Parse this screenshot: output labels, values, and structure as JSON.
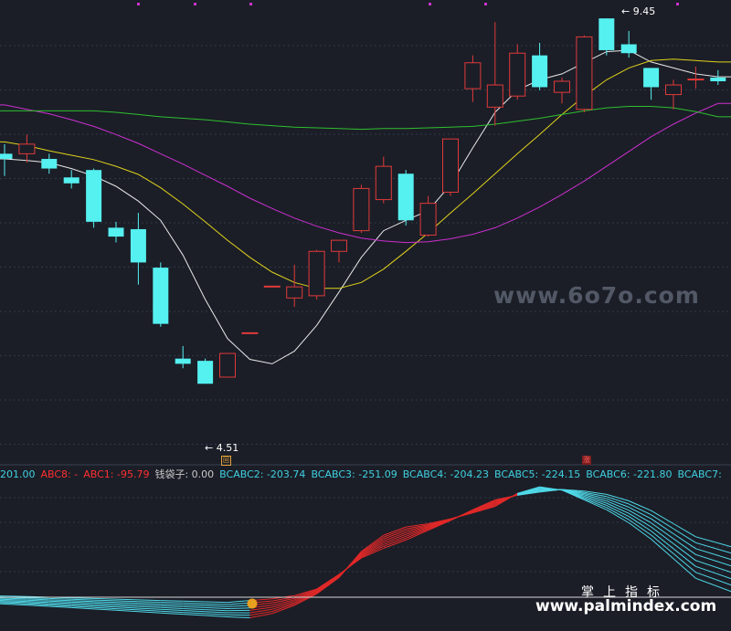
{
  "chart_data": [
    {
      "type": "candlestick",
      "price_range": [
        3.55,
        9.6
      ],
      "annotations": {
        "high_label": "9.45",
        "low_label": "4.51"
      },
      "candles": [
        {
          "o": 7.62,
          "h": 7.75,
          "l": 7.32,
          "c": 7.55
        },
        {
          "o": 7.62,
          "h": 7.88,
          "l": 7.5,
          "c": 7.75
        },
        {
          "o": 7.55,
          "h": 7.62,
          "l": 7.35,
          "c": 7.42
        },
        {
          "o": 7.3,
          "h": 7.4,
          "l": 7.15,
          "c": 7.22
        },
        {
          "o": 7.4,
          "h": 7.42,
          "l": 6.62,
          "c": 6.7
        },
        {
          "o": 6.62,
          "h": 6.7,
          "l": 6.42,
          "c": 6.5
        },
        {
          "o": 6.6,
          "h": 6.82,
          "l": 5.85,
          "c": 6.15
        },
        {
          "o": 6.08,
          "h": 6.15,
          "l": 5.28,
          "c": 5.32
        },
        {
          "o": 4.85,
          "h": 5.02,
          "l": 4.72,
          "c": 4.78
        },
        {
          "o": 4.82,
          "h": 4.85,
          "l": 4.51,
          "c": 4.51
        },
        {
          "o": 4.6,
          "h": 4.85,
          "l": 4.6,
          "c": 4.92
        },
        {
          "o": 5.2,
          "h": 5.2,
          "l": 5.2,
          "c": 5.2
        },
        {
          "o": 5.83,
          "h": 5.83,
          "l": 5.83,
          "c": 5.83
        },
        {
          "o": 5.67,
          "h": 6.12,
          "l": 5.55,
          "c": 5.82
        },
        {
          "o": 5.7,
          "h": 6.32,
          "l": 5.65,
          "c": 6.3
        },
        {
          "o": 6.3,
          "h": 6.45,
          "l": 6.15,
          "c": 6.45
        },
        {
          "o": 6.58,
          "h": 7.2,
          "l": 6.55,
          "c": 7.15
        },
        {
          "o": 7.0,
          "h": 7.58,
          "l": 6.95,
          "c": 7.45
        },
        {
          "o": 7.35,
          "h": 7.4,
          "l": 6.65,
          "c": 6.72
        },
        {
          "o": 6.52,
          "h": 7.05,
          "l": 6.5,
          "c": 6.95
        },
        {
          "o": 7.1,
          "h": 7.82,
          "l": 7.05,
          "c": 7.82
        },
        {
          "o": 8.5,
          "h": 8.95,
          "l": 8.32,
          "c": 8.85
        },
        {
          "o": 8.25,
          "h": 9.4,
          "l": 8.0,
          "c": 8.55
        },
        {
          "o": 8.4,
          "h": 9.1,
          "l": 8.35,
          "c": 8.98
        },
        {
          "o": 8.95,
          "h": 9.12,
          "l": 8.48,
          "c": 8.52
        },
        {
          "o": 8.45,
          "h": 8.65,
          "l": 8.3,
          "c": 8.6
        },
        {
          "o": 8.22,
          "h": 9.22,
          "l": 8.18,
          "c": 9.2
        },
        {
          "o": 9.45,
          "h": 9.45,
          "l": 8.95,
          "c": 9.02
        },
        {
          "o": 9.1,
          "h": 9.28,
          "l": 8.92,
          "c": 8.98
        },
        {
          "o": 8.78,
          "h": 8.78,
          "l": 8.35,
          "c": 8.52
        },
        {
          "o": 8.42,
          "h": 8.62,
          "l": 8.22,
          "c": 8.55
        },
        {
          "o": 8.62,
          "h": 8.8,
          "l": 8.5,
          "c": 8.63
        },
        {
          "o": 8.65,
          "h": 8.75,
          "l": 8.55,
          "c": 8.6
        }
      ],
      "ma_series": [
        {
          "color": "#e8e8e8",
          "values": [
            7.55,
            7.53,
            7.5,
            7.42,
            7.32,
            7.18,
            6.98,
            6.72,
            6.25,
            5.65,
            5.12,
            4.84,
            4.78,
            4.95,
            5.3,
            5.75,
            6.22,
            6.58,
            6.72,
            6.85,
            7.2,
            7.7,
            8.18,
            8.48,
            8.62,
            8.7,
            8.85,
            9.0,
            9.02,
            8.86,
            8.78,
            8.7,
            8.66
          ]
        },
        {
          "color": "#e0d21c",
          "values": [
            7.78,
            7.73,
            7.66,
            7.6,
            7.54,
            7.45,
            7.34,
            7.16,
            6.94,
            6.7,
            6.45,
            6.22,
            6.02,
            5.88,
            5.8,
            5.8,
            5.88,
            6.06,
            6.3,
            6.55,
            6.82,
            7.08,
            7.35,
            7.62,
            7.88,
            8.15,
            8.4,
            8.62,
            8.78,
            8.88,
            8.9,
            8.88,
            8.86
          ]
        },
        {
          "color": "#cc2fd0",
          "values": [
            8.28,
            8.22,
            8.16,
            8.08,
            7.99,
            7.88,
            7.76,
            7.62,
            7.48,
            7.33,
            7.18,
            7.02,
            6.88,
            6.75,
            6.64,
            6.55,
            6.48,
            6.44,
            6.42,
            6.43,
            6.47,
            6.53,
            6.62,
            6.75,
            6.9,
            7.07,
            7.25,
            7.45,
            7.65,
            7.85,
            8.02,
            8.17,
            8.3
          ]
        },
        {
          "color": "#2fbf2f",
          "values": [
            8.2,
            8.2,
            8.2,
            8.2,
            8.2,
            8.18,
            8.15,
            8.12,
            8.1,
            8.08,
            8.05,
            8.02,
            8.0,
            7.98,
            7.97,
            7.96,
            7.95,
            7.96,
            7.96,
            7.97,
            7.98,
            7.99,
            8.02,
            8.06,
            8.1,
            8.15,
            8.2,
            8.24,
            8.26,
            8.26,
            8.24,
            8.19,
            8.12
          ]
        }
      ]
    },
    {
      "type": "line",
      "legend": [
        {
          "text": "201.00",
          "color": "#3fd0e0"
        },
        {
          "text": "ABC8: -",
          "color": "#ff3030"
        },
        {
          "text": "ABC1: -95.79",
          "color": "#ff3030"
        },
        {
          "text": "钱袋子: 0.00",
          "color": "#c8c8c8"
        },
        {
          "text": "BCABC2: -203.74",
          "color": "#3fd0e0"
        },
        {
          "text": "BCABC3: -251.09",
          "color": "#3fd0e0"
        },
        {
          "text": "BCABC4: -204.23",
          "color": "#3fd0e0"
        },
        {
          "text": "BCABC5: -224.15",
          "color": "#3fd0e0"
        },
        {
          "text": "BCABC6: -221.80",
          "color": "#3fd0e0"
        },
        {
          "text": "BCABC7:",
          "color": "#3fd0e0"
        }
      ],
      "band": {
        "lower": [
          -20,
          -24,
          -28,
          -32,
          -36,
          -40,
          -44,
          -48,
          -52,
          -56,
          -60,
          -63,
          -50,
          -25,
          10,
          60,
          140,
          190,
          215,
          225,
          240,
          258,
          278,
          318,
          338,
          328,
          298,
          268,
          228,
          178,
          118,
          58,
          18
        ],
        "upper": [
          4,
          2,
          0,
          -2,
          -4,
          -6,
          -8,
          -10,
          -12,
          -14,
          -16,
          -10,
          -5,
          5,
          25,
          70,
          120,
          150,
          175,
          205,
          235,
          268,
          298,
          312,
          322,
          330,
          325,
          315,
          295,
          265,
          225,
          185,
          155
        ],
        "count": 8,
        "pivot_index": 23,
        "red_color": "#e02828",
        "cyan_color": "#4fd8e8"
      }
    }
  ],
  "watermarks": {
    "site1": "www.6o7o.com",
    "site2_cn": "掌上指标",
    "site2": "www.palmindex.com"
  },
  "icons": {
    "q_mark": "回",
    "zhang_mark": "涨"
  }
}
